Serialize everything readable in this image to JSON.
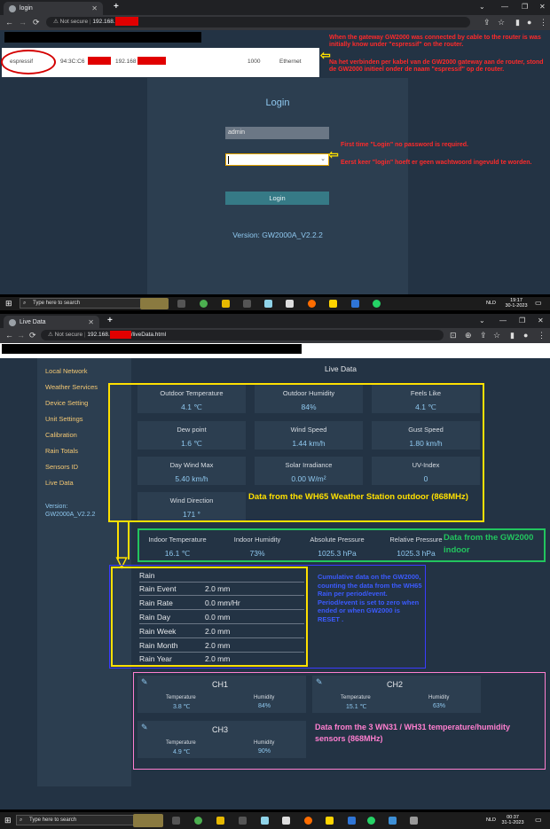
{
  "screen1": {
    "tab_title": "login",
    "url_prefix": "192.168.",
    "not_secure": "Not secure",
    "device_row": {
      "name": "espressif",
      "mac": "94:3C:C6",
      "ip": "192.168",
      "speed": "1000",
      "connection": "Ethernet"
    },
    "login": {
      "title": "Login",
      "username": "admin",
      "password": "",
      "button": "Login",
      "version": "Version: GW2000A_V2.2.2"
    },
    "annotation_en": "When the gateway GW2000 was connected by cable to the router is was initially know under \"espressif\" on the router.",
    "annotation_nl": "Na het verbinden per kabel van de GW2000 gateway aan de router, stond de GW2000 initieel onder de naam \"espressif\" op de router.",
    "annotation2_en": "First time \"Login\" no password is required.",
    "annotation2_nl": "Eerst keer \"login\" hoeft er geen wachtwoord ingevuld te worden.",
    "taskbar": {
      "search": "Type here to search",
      "lang": "NLD",
      "time": "19:17",
      "date": "30-1-2023"
    }
  },
  "screen2": {
    "tab_title": "Live Data",
    "url_prefix": "192.168.",
    "url_suffix": "/liveData.html",
    "not_secure": "Not secure",
    "menu": [
      "Local Network",
      "Weather Services",
      "Device Setting",
      "Unit Settings",
      "Calibration",
      "Rain Totals",
      "Sensors ID",
      "Live Data"
    ],
    "version_label": "Version:",
    "version": "GW2000A_V2.2.2",
    "page_title": "Live Data",
    "outdoor": [
      {
        "label": "Outdoor Temperature",
        "value": "4.1 ℃"
      },
      {
        "label": "Outdoor Humidity",
        "value": "84%"
      },
      {
        "label": "Feels Like",
        "value": "4.1 ℃"
      },
      {
        "label": "Dew point",
        "value": "1.6 ℃"
      },
      {
        "label": "Wind Speed",
        "value": "1.44 km/h"
      },
      {
        "label": "Gust Speed",
        "value": "1.80 km/h"
      },
      {
        "label": "Day Wind Max",
        "value": "5.40 km/h"
      },
      {
        "label": "Solar Irradiance",
        "value": "0.00 W/m²"
      },
      {
        "label": "UV-Index",
        "value": "0"
      },
      {
        "label": "Wind Direction",
        "value": "171 °"
      }
    ],
    "outdoor_note": "Data from the WH65 Weather Station outdoor (868MHz)",
    "indoor": [
      {
        "label": "Indoor Temperature",
        "value": "16.1 ℃"
      },
      {
        "label": "Indoor Humidity",
        "value": "73%"
      },
      {
        "label": "Absolute Pressure",
        "value": "1025.3 hPa"
      },
      {
        "label": "Relative Pressure",
        "value": "1025.3 hPa"
      }
    ],
    "indoor_note": "Data from the GW2000 indoor",
    "rain_header": "Rain",
    "rain": [
      {
        "label": "Rain Event",
        "value": "2.0 mm"
      },
      {
        "label": "Rain Rate",
        "value": "0.0 mm/Hr"
      },
      {
        "label": "Rain Day",
        "value": "0.0 mm"
      },
      {
        "label": "Rain Week",
        "value": "2.0 mm"
      },
      {
        "label": "Rain Month",
        "value": "2.0 mm"
      },
      {
        "label": "Rain Year",
        "value": "2.0 mm"
      }
    ],
    "rain_note": "Cumulative data on the GW2000, counting the data from the WH65 Rain per period/event. Period/event is set to zero when ended or when GW2000 is RESET .",
    "channels": [
      {
        "name": "CH1",
        "temp_label": "Temperature",
        "temp": "3.8 ℃",
        "hum_label": "Humidity",
        "hum": "84%"
      },
      {
        "name": "CH2",
        "temp_label": "Temperature",
        "temp": "15.1 ℃",
        "hum_label": "Humidity",
        "hum": "63%"
      },
      {
        "name": "CH3",
        "temp_label": "Temperature",
        "temp": "4.9 ℃",
        "hum_label": "Humidity",
        "hum": "90%"
      }
    ],
    "sensors_note": "Data from the 3  WN31 / WH31 temperature/humidity sensors (868MHz)",
    "taskbar": {
      "search": "Type here to search",
      "lang": "NLD",
      "time": "00:37",
      "date": "31-1-2023"
    }
  },
  "colors": {
    "accent": "#f4c873",
    "value": "#8fc8ef",
    "annotation": "#ff2a2a",
    "yellow": "#ffe000",
    "green": "#22c55e",
    "blue": "#3b3bff",
    "pink": "#ff7fd0"
  }
}
